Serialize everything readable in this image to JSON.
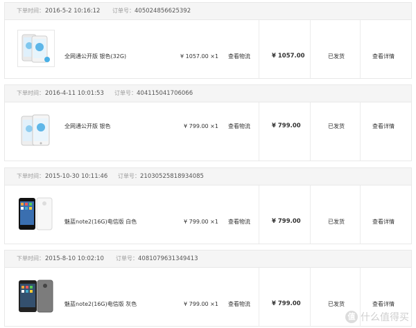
{
  "labels": {
    "order_time": "下单时间：",
    "order_no": "订单号：",
    "logistics": "查看物流",
    "status": "已发货",
    "details": "查看详情"
  },
  "orders": [
    {
      "time": "2016-5-2 10:16:12",
      "number": "405024856625392",
      "product": "全网通公开版 银色(32G)",
      "unit_price": "¥ 1057.00 ×1",
      "total": "¥ 1057.00"
    },
    {
      "time": "2016-4-11 10:01:53",
      "number": "404115041706066",
      "product": "全网通公开版 银色",
      "unit_price": "¥ 799.00 ×1",
      "total": "¥ 799.00"
    },
    {
      "time": "2015-10-30 10:11:46",
      "number": "210305258189340​85",
      "product": "魅蓝note2(16G)电信版 白色",
      "unit_price": "¥ 799.00 ×1",
      "total": "¥ 799.00"
    },
    {
      "time": "2015-8-10 10:02:10",
      "number": "4081079631349413",
      "product": "魅蓝note2(16G)电信版 灰色",
      "unit_price": "¥ 799.00 ×1",
      "total": "¥ 799.00"
    }
  ],
  "watermark": {
    "icon_text": "值",
    "text": "什么值得买"
  }
}
